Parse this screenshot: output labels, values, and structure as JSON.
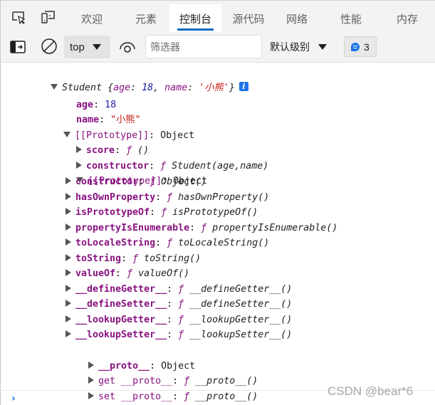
{
  "tabbar": {
    "icons": [
      "inspect-element-icon",
      "device-emulation-icon"
    ],
    "tabs": [
      {
        "label": "欢迎",
        "active": false
      },
      {
        "label": "元素",
        "active": false
      },
      {
        "label": "控制台",
        "active": true
      },
      {
        "label": "源代码",
        "active": false
      },
      {
        "label": "网络",
        "active": false
      },
      {
        "label": "性能",
        "active": false
      },
      {
        "label": "内存",
        "active": false
      }
    ]
  },
  "toolbar": {
    "context": "top",
    "filter_placeholder": "筛选器",
    "filter_value": "",
    "level": "默认级别",
    "message_count": "3"
  },
  "console": {
    "summary": {
      "class_name": "Student",
      "open_brace": " {",
      "k1": "age",
      "v1": "18",
      "sep": ", ",
      "k2": "name",
      "v2": "'小熊'",
      "close_brace": "}"
    },
    "props": [
      {
        "key": "age",
        "value": "18",
        "type": "number"
      },
      {
        "key": "name",
        "value": "\"小熊\"",
        "type": "string"
      }
    ],
    "prototype_label": "[[Prototype]]",
    "prototype_value": "Object",
    "proto_members": [
      {
        "key": "score",
        "fn": "()"
      },
      {
        "key": "constructor",
        "fn": "Student(age,name)"
      }
    ],
    "object_proto_label": "[[Prototype]]",
    "object_proto_value": "Object",
    "object_members": [
      {
        "key": "constructor",
        "fn": "Object()"
      },
      {
        "key": "hasOwnProperty",
        "fn": "hasOwnProperty()"
      },
      {
        "key": "isPrototypeOf",
        "fn": "isPrototypeOf()"
      },
      {
        "key": "propertyIsEnumerable",
        "fn": "propertyIsEnumerable()"
      },
      {
        "key": "toLocaleString",
        "fn": "toLocaleString()"
      },
      {
        "key": "toString",
        "fn": "toString()"
      },
      {
        "key": "valueOf",
        "fn": "valueOf()"
      },
      {
        "key": "__defineGetter__",
        "fn": "__defineGetter__()"
      },
      {
        "key": "__defineSetter__",
        "fn": "__defineSetter__()"
      },
      {
        "key": "__lookupGetter__",
        "fn": "__lookupGetter__()"
      },
      {
        "key": "__lookupSetter__",
        "fn": "__lookupSetter__()"
      }
    ],
    "proto_accessor": {
      "key": "__proto__",
      "value": "Object"
    },
    "getter": {
      "prefix": "get ",
      "key": "__proto__",
      "fn": "__proto__()"
    },
    "setter": {
      "prefix": "set ",
      "key": "__proto__",
      "fn": "__proto__()"
    },
    "f_symbol": "ƒ",
    "prompt": "›"
  },
  "watermark": "CSDN @bear*6"
}
